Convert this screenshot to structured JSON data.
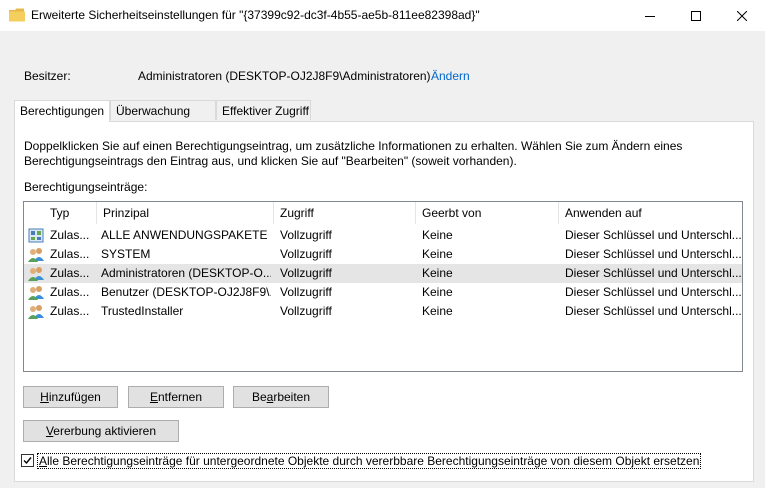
{
  "window": {
    "title": "Erweiterte Sicherheitseinstellungen für \"{37399c92-dc3f-4b55-ae5b-811ee82398ad}\""
  },
  "owner": {
    "label": "Besitzer:",
    "value": "Administratoren (DESKTOP-OJ2J8F9\\Administratoren)",
    "change_link": "Ändern"
  },
  "tabs": [
    {
      "label": "Berechtigungen",
      "active": true
    },
    {
      "label": "Überwachung",
      "active": false
    },
    {
      "label": "Effektiver Zugriff",
      "active": false
    }
  ],
  "permissions": {
    "description": "Doppelklicken Sie auf einen Berechtigungseintrag, um zusätzliche Informationen zu erhalten. Wählen Sie zum Ändern eines Berechtigungseintrags den Eintrag aus, und klicken Sie auf \"Bearbeiten\" (soweit vorhanden).",
    "entries_label": "Berechtigungseinträge:",
    "columns": [
      "Typ",
      "Prinzipal",
      "Zugriff",
      "Geerbt von",
      "Anwenden auf"
    ],
    "rows": [
      {
        "type": "Zulas...",
        "principal": "ALLE ANWENDUNGSPAKETE",
        "access": "Vollzugriff",
        "inherited": "Keine",
        "applies": "Dieser Schlüssel und Unterschl...",
        "icon": "app-packages-icon",
        "selected": false
      },
      {
        "type": "Zulas...",
        "principal": "SYSTEM",
        "access": "Vollzugriff",
        "inherited": "Keine",
        "applies": "Dieser Schlüssel und Unterschl...",
        "icon": "user-group-icon",
        "selected": false
      },
      {
        "type": "Zulas...",
        "principal": "Administratoren (DESKTOP-O...",
        "access": "Vollzugriff",
        "inherited": "Keine",
        "applies": "Dieser Schlüssel und Unterschl...",
        "icon": "user-group-icon",
        "selected": true
      },
      {
        "type": "Zulas...",
        "principal": "Benutzer (DESKTOP-OJ2J8F9\\...",
        "access": "Vollzugriff",
        "inherited": "Keine",
        "applies": "Dieser Schlüssel und Unterschl...",
        "icon": "user-group-icon",
        "selected": false
      },
      {
        "type": "Zulas...",
        "principal": "TrustedInstaller",
        "access": "Vollzugriff",
        "inherited": "Keine",
        "applies": "Dieser Schlüssel und Unterschl...",
        "icon": "user-group-icon",
        "selected": false
      }
    ]
  },
  "buttons": {
    "add": {
      "pre": "",
      "key": "H",
      "post": "inzufügen"
    },
    "remove": {
      "pre": "",
      "key": "E",
      "post": "ntfernen"
    },
    "edit": {
      "pre": "Be",
      "key": "a",
      "post": "rbeiten"
    },
    "inherit": {
      "pre": "",
      "key": "V",
      "post": "ererbung aktivieren"
    }
  },
  "replace_checkbox": {
    "checked": true,
    "key": "A",
    "label_rest": "lle Berechtigungseinträge für untergeordnete Objekte durch vererbbare Berechtigungseinträge von diesem Objekt ersetzen"
  },
  "colors": {
    "link": "#0066cc",
    "selected_row": "#e5e5e5",
    "folder": "#f2c94c"
  }
}
